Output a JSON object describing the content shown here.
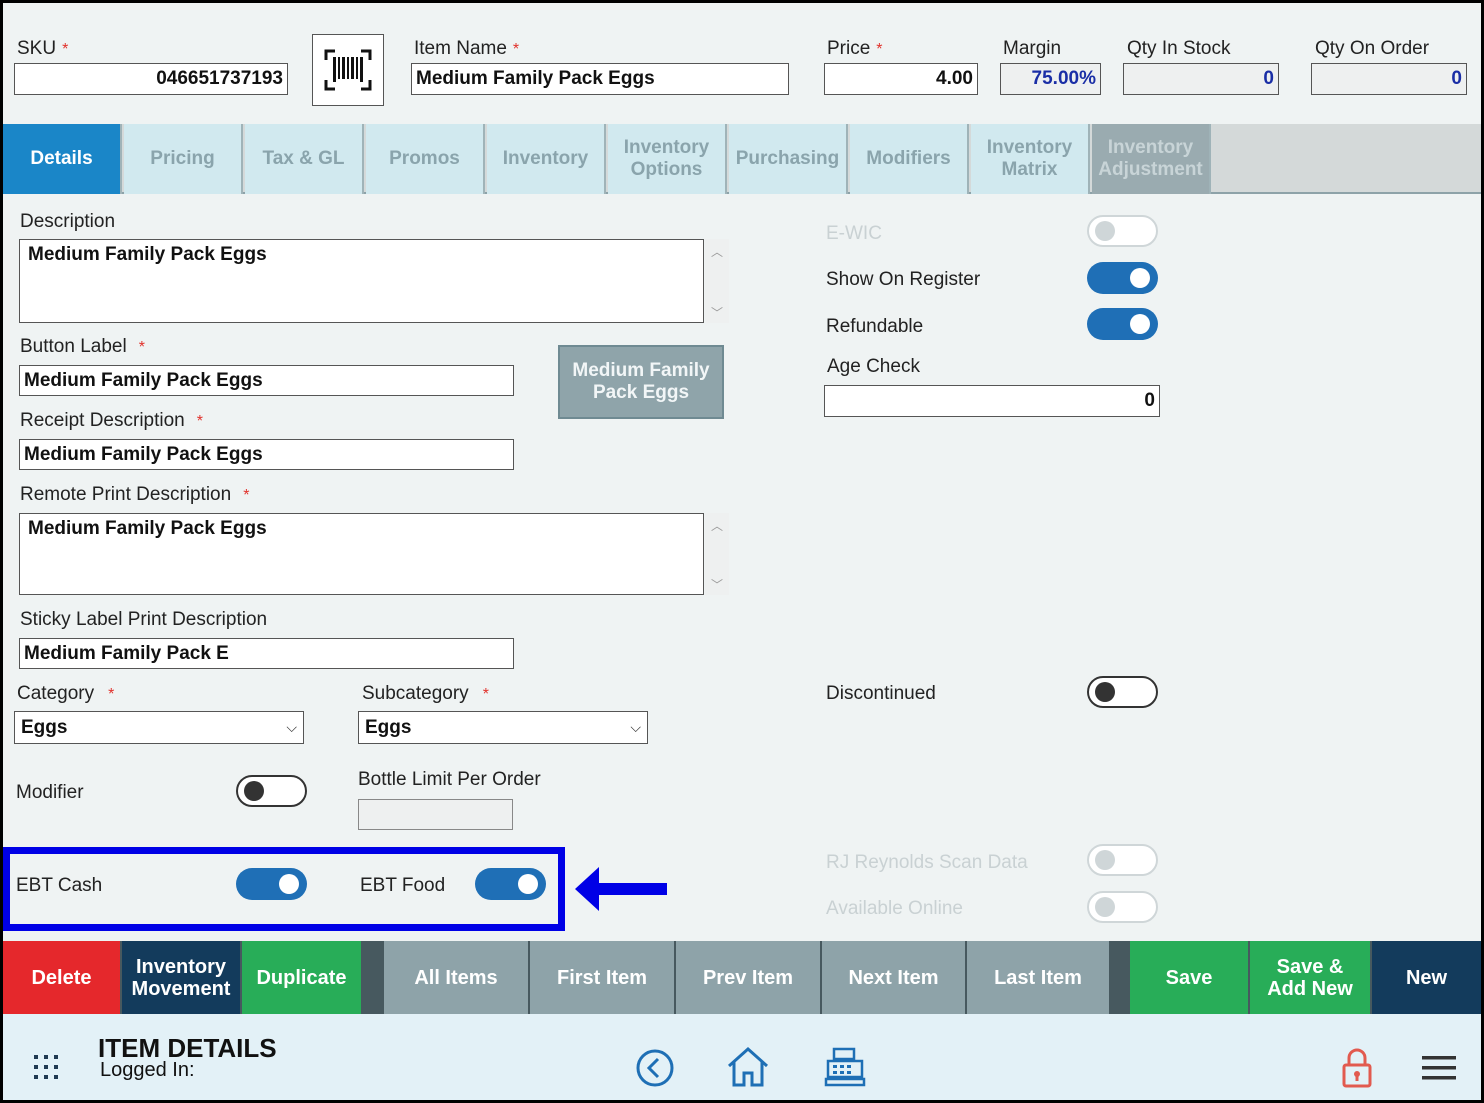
{
  "header": {
    "sku_label": "SKU",
    "sku_value": "046651737193",
    "item_name_label": "Item Name",
    "item_name_value": "Medium Family Pack Eggs",
    "price_label": "Price",
    "price_value": "4.00",
    "margin_label": "Margin",
    "margin_value": "75.00%",
    "qty_in_stock_label": "Qty In Stock",
    "qty_in_stock_value": "0",
    "qty_on_order_label": "Qty On Order",
    "qty_on_order_value": "0",
    "required_mark": "*"
  },
  "tabs": [
    {
      "label": "Details",
      "state": "active"
    },
    {
      "label": "Pricing",
      "state": "normal"
    },
    {
      "label": "Tax & GL",
      "state": "normal"
    },
    {
      "label": "Promos",
      "state": "normal"
    },
    {
      "label": "Inventory",
      "state": "normal"
    },
    {
      "label": "Inventory Options",
      "state": "normal"
    },
    {
      "label": "Purchasing",
      "state": "normal"
    },
    {
      "label": "Modifiers",
      "state": "normal"
    },
    {
      "label": "Inventory Matrix",
      "state": "normal"
    },
    {
      "label": "Inventory Adjustment",
      "state": "disabled"
    }
  ],
  "form": {
    "description_label": "Description",
    "description_value": "Medium Family Pack Eggs",
    "button_label_label": "Button Label",
    "button_label_value": "Medium Family Pack Eggs",
    "button_preview": "Medium Family Pack Eggs",
    "receipt_desc_label": "Receipt Description",
    "receipt_desc_value": "Medium Family Pack Eggs",
    "remote_print_label": "Remote Print Description",
    "remote_print_value": "Medium Family Pack Eggs",
    "sticky_label_label": "Sticky Label Print Description",
    "sticky_label_value": "Medium Family Pack E",
    "category_label": "Category",
    "category_value": "Eggs",
    "subcategory_label": "Subcategory",
    "subcategory_value": "Eggs",
    "modifier_label": "Modifier",
    "bottle_limit_label": "Bottle Limit Per Order",
    "bottle_limit_value": "",
    "ebt_cash_label": "EBT Cash",
    "ebt_food_label": "EBT Food"
  },
  "right_panel": {
    "ewic_label": "E-WIC",
    "show_on_register_label": "Show On Register",
    "refundable_label": "Refundable",
    "age_check_label": "Age Check",
    "age_check_value": "0",
    "discontinued_label": "Discontinued",
    "rj_reynolds_label": "RJ Reynolds Scan Data",
    "available_online_label": "Available Online"
  },
  "toggles": {
    "ewic": "disabled",
    "show_on_register": "on",
    "refundable": "on",
    "discontinued": "off",
    "modifier": "off",
    "ebt_cash": "on",
    "ebt_food": "on",
    "rj_reynolds": "disabled",
    "available_online": "disabled"
  },
  "actions": {
    "delete": "Delete",
    "inventory_movement": "Inventory Movement",
    "duplicate": "Duplicate",
    "all_items": "All Items",
    "first_item": "First Item",
    "prev_item": "Prev Item",
    "next_item": "Next Item",
    "last_item": "Last Item",
    "save": "Save",
    "save_add_new": "Save & Add New",
    "new": "New"
  },
  "footer": {
    "title": "ITEM DETAILS",
    "logged_in": "Logged In:"
  },
  "colors": {
    "accent_blue": "#1a86c8",
    "highlight_blue": "#0000e6",
    "delete_red": "#e5282c",
    "save_green": "#28ad58",
    "navy": "#133b5c"
  },
  "icons": [
    "barcode-icon",
    "grid-menu-icon",
    "back-circle-icon",
    "home-icon",
    "cash-register-icon",
    "lock-icon",
    "hamburger-menu-icon",
    "left-arrow-icon"
  ]
}
